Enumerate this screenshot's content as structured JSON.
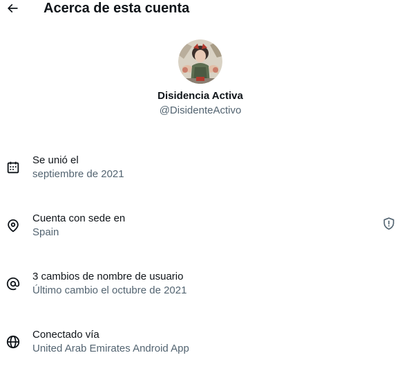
{
  "header": {
    "title": "Acerca de esta cuenta",
    "back_icon": "arrow-left-icon"
  },
  "profile": {
    "display_name": "Disidencia Activa",
    "handle": "@DisidenteActivo"
  },
  "rows": [
    {
      "icon": "calendar-icon",
      "title": "Se unió el",
      "value": "septiembre de 2021"
    },
    {
      "icon": "location-pin-icon",
      "title": "Cuenta con sede en",
      "value": "Spain",
      "extra_icon": "shield-alert-icon"
    },
    {
      "icon": "at-sign-icon",
      "title": "3 cambios de nombre de usuario",
      "value": "Último cambio el octubre de 2021"
    },
    {
      "icon": "globe-icon",
      "title": "Conectado vía",
      "value": "United Arab Emirates Android App"
    }
  ],
  "colors": {
    "text_primary": "#0f1419",
    "text_secondary": "#536471"
  }
}
